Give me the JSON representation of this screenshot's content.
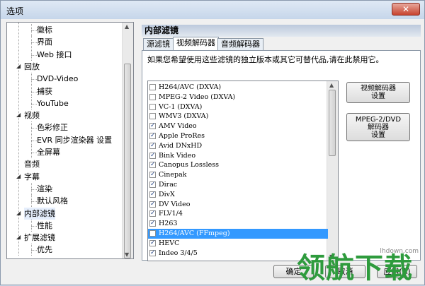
{
  "window": {
    "title": "选项",
    "close_glyph": "✕"
  },
  "tree": {
    "items": [
      {
        "label": "徽标",
        "level": 2
      },
      {
        "label": "界面",
        "level": 2
      },
      {
        "label": "Web 接口",
        "level": 2
      },
      {
        "label": "回放",
        "level": 1,
        "toggle": "◢"
      },
      {
        "label": "DVD-Video",
        "level": 2
      },
      {
        "label": "捕获",
        "level": 2
      },
      {
        "label": "YouTube",
        "level": 2
      },
      {
        "label": "视频",
        "level": 1,
        "toggle": "◢"
      },
      {
        "label": "色彩修正",
        "level": 2
      },
      {
        "label": "EVR 同步渲染器 设置",
        "level": 2
      },
      {
        "label": "全屏幕",
        "level": 2
      },
      {
        "label": "音频",
        "level": 1
      },
      {
        "label": "字幕",
        "level": 1,
        "toggle": "◢"
      },
      {
        "label": "渲染",
        "level": 2
      },
      {
        "label": "默认风格",
        "level": 2
      },
      {
        "label": "内部滤镜",
        "level": 1,
        "toggle": "◢",
        "selected": true
      },
      {
        "label": "性能",
        "level": 2
      },
      {
        "label": "扩展滤镜",
        "level": 1,
        "toggle": "◢"
      },
      {
        "label": "优先",
        "level": 2
      }
    ]
  },
  "panel": {
    "title": "内部滤镜",
    "tabs": [
      {
        "label": "源滤镜",
        "active": false
      },
      {
        "label": "视频解码器",
        "active": true
      },
      {
        "label": "音频解码器",
        "active": false
      }
    ],
    "description": "如果您希望使用这些滤镜的独立版本或其它可替代品,请在此禁用它。",
    "decoders": [
      {
        "label": "H264/AVC (DXVA)",
        "checked": false
      },
      {
        "label": "MPEG-2 Video (DXVA)",
        "checked": false
      },
      {
        "label": "VC-1 (DXVA)",
        "checked": false
      },
      {
        "label": "WMV3 (DXVA)",
        "checked": false
      },
      {
        "label": "AMV Video",
        "checked": true
      },
      {
        "label": "Apple ProRes",
        "checked": true
      },
      {
        "label": "Avid DNxHD",
        "checked": true
      },
      {
        "label": "Bink Video",
        "checked": true
      },
      {
        "label": "Canopus Lossless",
        "checked": true
      },
      {
        "label": "Cinepak",
        "checked": true
      },
      {
        "label": "Dirac",
        "checked": true
      },
      {
        "label": "DivX",
        "checked": true
      },
      {
        "label": "DV Video",
        "checked": true
      },
      {
        "label": "FLV1/4",
        "checked": true
      },
      {
        "label": "H263",
        "checked": true
      },
      {
        "label": "H264/AVC (FFmpeg)",
        "checked": false,
        "selected": true
      },
      {
        "label": "HEVC",
        "checked": true
      },
      {
        "label": "Indeo 3/4/5",
        "checked": true
      }
    ],
    "video_decoder_settings": "视频解码器\n设置",
    "mpeg2_dvd_settings": "MPEG-2/DVD\n解码器\n设置"
  },
  "footer": {
    "ok": "确定",
    "cancel": "取消",
    "apply": "应用(A)"
  },
  "watermark": {
    "text": "领航下载",
    "url": "lhdown.com",
    "color": "#2e9b3d"
  }
}
